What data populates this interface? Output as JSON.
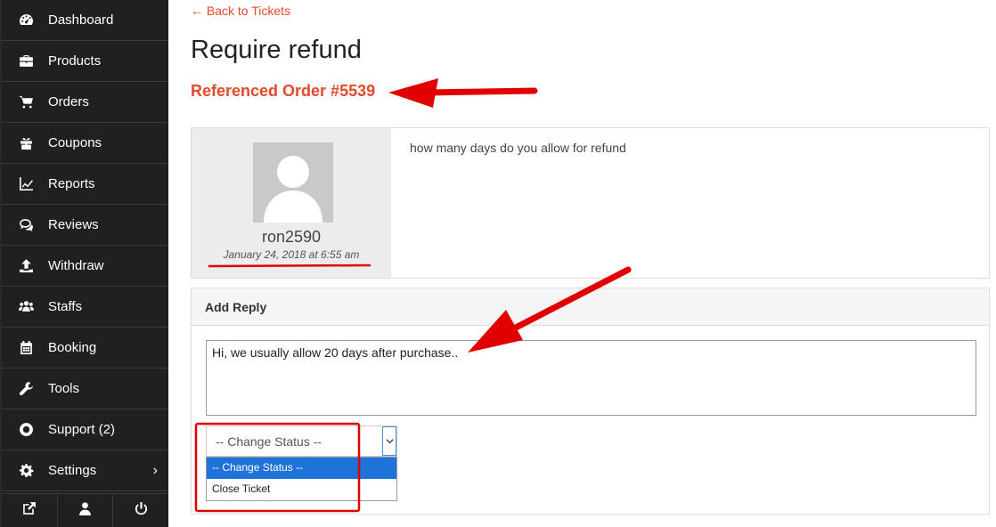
{
  "sidebar": {
    "items": [
      {
        "label": "Dashboard",
        "icon": "dashboard-icon"
      },
      {
        "label": "Products",
        "icon": "briefcase-icon"
      },
      {
        "label": "Orders",
        "icon": "cart-icon"
      },
      {
        "label": "Coupons",
        "icon": "gift-icon"
      },
      {
        "label": "Reports",
        "icon": "chart-line-icon"
      },
      {
        "label": "Reviews",
        "icon": "comments-icon"
      },
      {
        "label": "Withdraw",
        "icon": "upload-icon"
      },
      {
        "label": "Staffs",
        "icon": "users-icon"
      },
      {
        "label": "Booking",
        "icon": "calendar-icon"
      },
      {
        "label": "Tools",
        "icon": "wrench-icon"
      },
      {
        "label": "Support (2)",
        "icon": "lifebuoy-icon"
      },
      {
        "label": "Settings",
        "icon": "gear-icon"
      }
    ],
    "bottom": [
      "external-link-icon",
      "user-icon",
      "power-icon"
    ]
  },
  "main": {
    "back_link": "← Back to Tickets",
    "title": "Require refund",
    "order_ref": "Referenced Order #5539",
    "ticket": {
      "author": "ron2590",
      "date": "January 24, 2018 at 6:55 am",
      "message": "how many days do you allow for refund"
    },
    "reply": {
      "heading": "Add Reply",
      "text": "Hi, we usually allow 20 days after purchase..",
      "status_value": "-- Change Status --",
      "status_options": [
        "-- Change Status --",
        "Close Ticket"
      ]
    }
  },
  "colors": {
    "accent": "#e24a2b",
    "sidebar": "#202020",
    "annotation": "#e00000",
    "selected": "#1e73d8"
  }
}
